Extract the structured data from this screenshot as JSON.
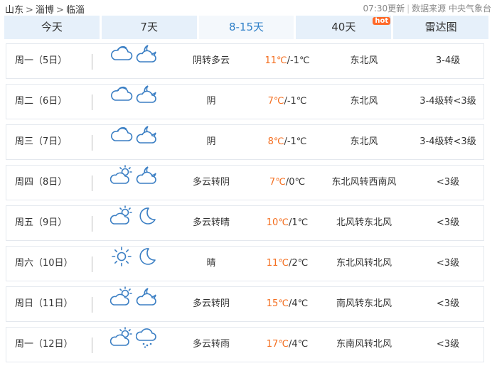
{
  "breadcrumb": [
    "山东",
    "淄博",
    "临淄"
  ],
  "update_time": "07:30更新",
  "source_label": "数据来源 中央气象台",
  "tabs": [
    {
      "label": "今天"
    },
    {
      "label": "7天"
    },
    {
      "label": "8-15天",
      "active": true
    },
    {
      "label": "40天",
      "badge": "hot"
    },
    {
      "label": "雷达图"
    }
  ],
  "days": [
    {
      "day": "周一（5日）",
      "icons": [
        "cloudy-icon",
        "partly-cloudy-night-icon"
      ],
      "desc": "阴转多云",
      "high": "11℃",
      "low": "-1℃",
      "wind": "东北风",
      "level": "3-4级"
    },
    {
      "day": "周二（6日）",
      "icons": [
        "cloudy-icon",
        "partly-cloudy-night-icon"
      ],
      "desc": "阴",
      "high": "7℃",
      "low": "-1℃",
      "wind": "东北风",
      "level": "3-4级转<3级"
    },
    {
      "day": "周三（7日）",
      "icons": [
        "cloudy-icon",
        "partly-cloudy-night-icon"
      ],
      "desc": "阴",
      "high": "8℃",
      "low": "-1℃",
      "wind": "东北风",
      "level": "3-4级转<3级"
    },
    {
      "day": "周四（8日）",
      "icons": [
        "partly-cloudy-day-icon",
        "partly-cloudy-night-icon"
      ],
      "desc": "多云转阴",
      "high": "7℃",
      "low": "0℃",
      "wind": "东北风转西南风",
      "level": "<3级"
    },
    {
      "day": "周五（9日）",
      "icons": [
        "partly-cloudy-day-icon",
        "moon-icon"
      ],
      "desc": "多云转晴",
      "high": "10℃",
      "low": "1℃",
      "wind": "北风转东北风",
      "level": "<3级"
    },
    {
      "day": "周六（10日）",
      "icons": [
        "sun-icon",
        "moon-icon"
      ],
      "desc": "晴",
      "high": "11℃",
      "low": "2℃",
      "wind": "东北风转北风",
      "level": "<3级"
    },
    {
      "day": "周日（11日）",
      "icons": [
        "partly-cloudy-day-icon",
        "partly-cloudy-night-icon"
      ],
      "desc": "多云转阴",
      "high": "15℃",
      "low": "4℃",
      "wind": "南风转东北风",
      "level": "<3级"
    },
    {
      "day": "周一（12日）",
      "icons": [
        "partly-cloudy-day-icon",
        "rain-icon"
      ],
      "desc": "多云转雨",
      "high": "17℃",
      "low": "4℃",
      "wind": "东南风转北风",
      "level": "<3级"
    }
  ],
  "colors": {
    "accent": "#2f80c8",
    "tab_bg": "#e6f0fa",
    "high_temp": "#f46e1f",
    "hot_badge": "#ff6a2a",
    "icon_stroke": "#3b7fc4"
  }
}
